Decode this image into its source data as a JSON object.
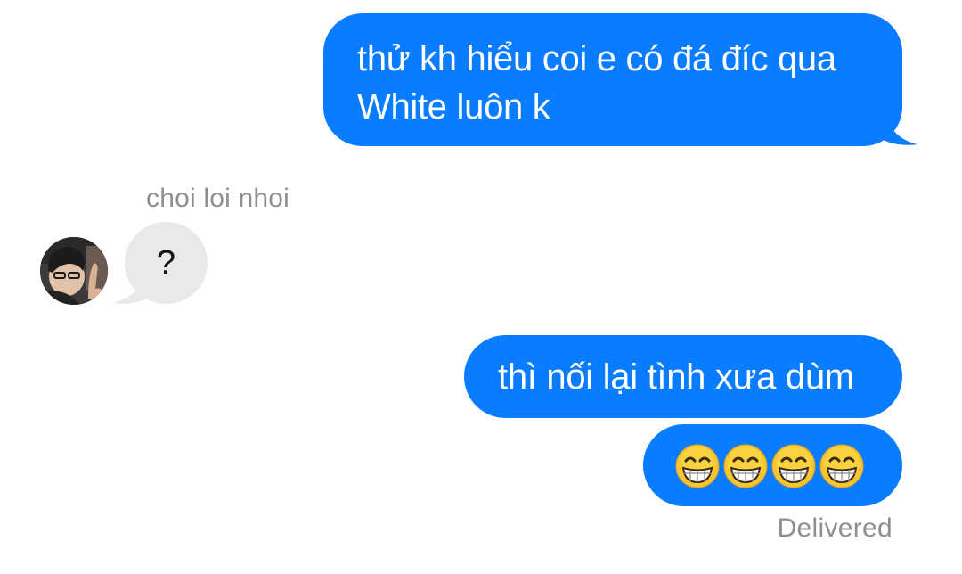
{
  "conversation": {
    "messages": [
      {
        "direction": "sent",
        "text": "thử kh hiểu coi e có đá đíc qua\nWhite luôn k"
      },
      {
        "direction": "received",
        "sender": "choi loi nhoi",
        "text": "?"
      },
      {
        "direction": "sent",
        "text": "thì nối lại tình xưa dùm"
      },
      {
        "direction": "sent",
        "emoji": [
          "grinning-face-with-smiling-eyes",
          "grinning-face-with-smiling-eyes",
          "grinning-face-with-smiling-eyes",
          "grinning-face-with-smiling-eyes"
        ]
      }
    ],
    "status": "Delivered"
  },
  "colors": {
    "sent_bubble": "#0a7cff",
    "received_bubble": "#e9e9eb",
    "meta_text": "#8e8e93",
    "background": "#ffffff"
  }
}
